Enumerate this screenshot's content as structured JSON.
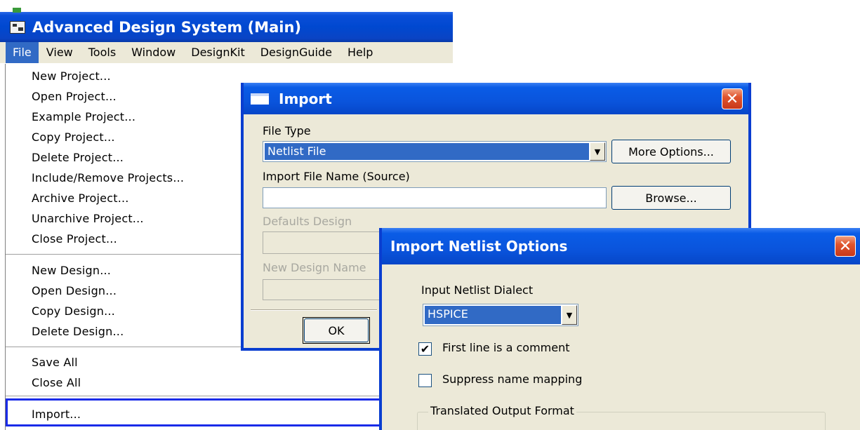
{
  "main_window": {
    "title": "Advanced Design System (Main)",
    "menubar": [
      "File",
      "View",
      "Tools",
      "Window",
      "DesignKit",
      "DesignGuide",
      "Help"
    ],
    "file_menu": [
      "New Project...",
      "Open Project...",
      "Example Project...",
      "Copy Project...",
      "Delete Project...",
      "Include/Remove Projects...",
      "Archive Project...",
      "Unarchive Project...",
      "Close Project...",
      "New Design...",
      "Open Design...",
      "Copy Design...",
      "Delete Design...",
      "Save All",
      "Close All",
      "Import..."
    ]
  },
  "import_dialog": {
    "title": "Import",
    "file_type_label": "File Type",
    "file_type_value": "Netlist File",
    "more_options_label": "More Options...",
    "source_label": "Import File Name (Source)",
    "source_value": "",
    "browse_label": "Browse...",
    "defaults_design_label": "Defaults Design",
    "new_design_name_label": "New Design Name",
    "ok_label": "OK",
    "close_glyph": "✕"
  },
  "netlist_dialog": {
    "title": "Import Netlist Options",
    "dialect_label": "Input Netlist Dialect",
    "dialect_value": "HSPICE",
    "first_line_comment_label": "First line is a comment",
    "first_line_comment_checked": true,
    "suppress_mapping_label": "Suppress name mapping",
    "suppress_mapping_checked": false,
    "output_group_label": "Translated Output Format",
    "close_glyph": "✕",
    "check_glyph": "✔"
  },
  "colors": {
    "title_blue": "#0a54dc",
    "selection_blue": "#316ac5",
    "highlight_border": "#1a2be8",
    "close_red": "#e0552e",
    "dialog_face": "#ece9d8"
  }
}
